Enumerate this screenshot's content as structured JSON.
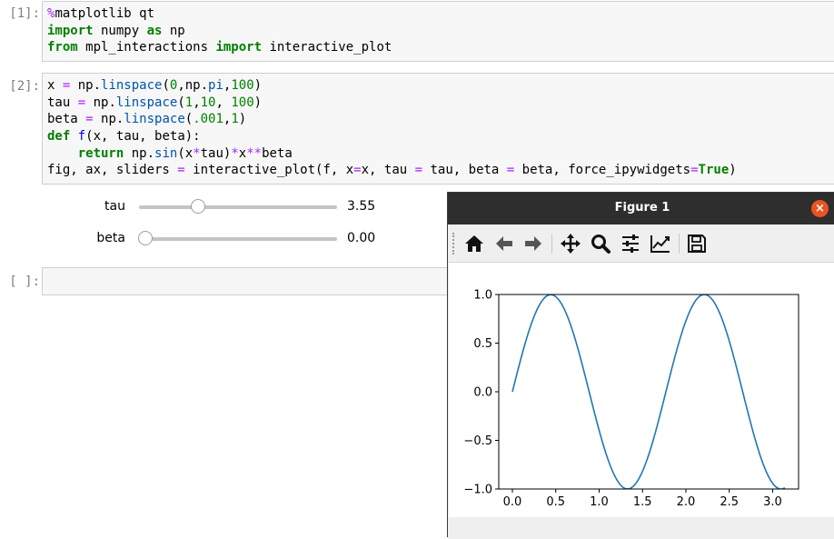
{
  "cells": [
    {
      "prompt": "[1]:",
      "lines": [
        [
          {
            "t": "%",
            "c": "op"
          },
          {
            "t": "matplotlib qt",
            "c": ""
          }
        ],
        [
          {
            "t": "import",
            "c": "kw"
          },
          {
            "t": " numpy ",
            "c": ""
          },
          {
            "t": "as",
            "c": "kw"
          },
          {
            "t": " np",
            "c": ""
          }
        ],
        [
          {
            "t": "from",
            "c": "kw"
          },
          {
            "t": " mpl_interactions ",
            "c": ""
          },
          {
            "t": "import",
            "c": "kw"
          },
          {
            "t": " interactive_plot",
            "c": ""
          }
        ]
      ]
    },
    {
      "prompt": "[2]:",
      "lines": [
        [
          {
            "t": "x ",
            "c": ""
          },
          {
            "t": "=",
            "c": "op"
          },
          {
            "t": " np.",
            "c": ""
          },
          {
            "t": "linspace",
            "c": "attr"
          },
          {
            "t": "(",
            "c": ""
          },
          {
            "t": "0",
            "c": "num"
          },
          {
            "t": ",np.",
            "c": ""
          },
          {
            "t": "pi",
            "c": "attr"
          },
          {
            "t": ",",
            "c": ""
          },
          {
            "t": "100",
            "c": "num"
          },
          {
            "t": ")",
            "c": ""
          }
        ],
        [
          {
            "t": "tau ",
            "c": ""
          },
          {
            "t": "=",
            "c": "op"
          },
          {
            "t": " np.",
            "c": ""
          },
          {
            "t": "linspace",
            "c": "attr"
          },
          {
            "t": "(",
            "c": ""
          },
          {
            "t": "1",
            "c": "num"
          },
          {
            "t": ",",
            "c": ""
          },
          {
            "t": "10",
            "c": "num"
          },
          {
            "t": ", ",
            "c": ""
          },
          {
            "t": "100",
            "c": "num"
          },
          {
            "t": ")",
            "c": ""
          }
        ],
        [
          {
            "t": "beta ",
            "c": ""
          },
          {
            "t": "=",
            "c": "op"
          },
          {
            "t": " np.",
            "c": ""
          },
          {
            "t": "linspace",
            "c": "attr"
          },
          {
            "t": "(",
            "c": ""
          },
          {
            "t": ".001",
            "c": "num"
          },
          {
            "t": ",",
            "c": ""
          },
          {
            "t": "1",
            "c": "num"
          },
          {
            "t": ")",
            "c": ""
          }
        ],
        [
          {
            "t": "def",
            "c": "kw"
          },
          {
            "t": " ",
            "c": ""
          },
          {
            "t": "f",
            "c": "fn"
          },
          {
            "t": "(x, tau, beta):",
            "c": ""
          }
        ],
        [
          {
            "t": "    ",
            "c": ""
          },
          {
            "t": "return",
            "c": "kw"
          },
          {
            "t": " np.",
            "c": ""
          },
          {
            "t": "sin",
            "c": "attr"
          },
          {
            "t": "(x",
            "c": ""
          },
          {
            "t": "*",
            "c": "op"
          },
          {
            "t": "tau)",
            "c": ""
          },
          {
            "t": "*",
            "c": "op"
          },
          {
            "t": "x",
            "c": ""
          },
          {
            "t": "**",
            "c": "op"
          },
          {
            "t": "beta",
            "c": ""
          }
        ],
        [
          {
            "t": "fig, ax, sliders ",
            "c": ""
          },
          {
            "t": "=",
            "c": "op"
          },
          {
            "t": " interactive_plot(f, x",
            "c": ""
          },
          {
            "t": "=",
            "c": "op"
          },
          {
            "t": "x, tau ",
            "c": ""
          },
          {
            "t": "=",
            "c": "op"
          },
          {
            "t": " tau, beta ",
            "c": ""
          },
          {
            "t": "=",
            "c": "op"
          },
          {
            "t": " beta, force_ipywidgets",
            "c": ""
          },
          {
            "t": "=",
            "c": "op"
          },
          {
            "t": "True",
            "c": "const"
          },
          {
            "t": ")",
            "c": ""
          }
        ]
      ]
    },
    {
      "prompt": "[ ]:",
      "lines": []
    }
  ],
  "sliders": [
    {
      "label": "tau",
      "value": "3.55",
      "fraction": 0.2844
    },
    {
      "label": "beta",
      "value": "0.00",
      "fraction": 0.0
    }
  ],
  "figure": {
    "title": "Figure 1",
    "close_glyph": "×",
    "toolbar": [
      "home-icon",
      "back-icon",
      "forward-icon",
      "pan-icon",
      "zoom-icon",
      "configure-subplots-icon",
      "edit-axes-icon",
      "save-icon"
    ]
  },
  "chart_data": {
    "type": "line",
    "function": "sin(x*tau)*x**beta",
    "tau": 3.55,
    "beta": 0.001,
    "x_range": [
      0,
      3.14159
    ],
    "xlim": [
      -0.157,
      3.299
    ],
    "ylim": [
      -1.0,
      1.0
    ],
    "xticks": [
      0.0,
      0.5,
      1.0,
      1.5,
      2.0,
      2.5,
      3.0
    ],
    "xtick_labels": [
      "0.0",
      "0.5",
      "1.0",
      "1.5",
      "2.0",
      "2.5",
      "3.0"
    ],
    "yticks": [
      1.0,
      0.5,
      0.0,
      -0.5,
      -1.0
    ],
    "ytick_labels": [
      "1.0",
      "0.5",
      "0.0",
      "−0.5",
      "−1.0"
    ],
    "color": "#1f77b4",
    "grid": false
  }
}
